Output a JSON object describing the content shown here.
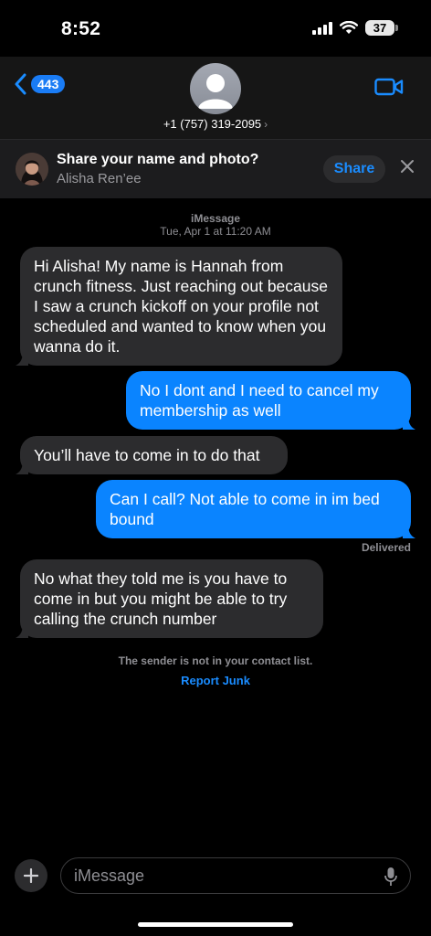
{
  "status_bar": {
    "time": "8:52",
    "battery": "37",
    "icons": [
      "signal-icon",
      "wifi-icon",
      "battery-icon"
    ]
  },
  "header": {
    "back_count": "443",
    "phone_number": "+1 (757) 319-2095",
    "icons": [
      "back-chevron-icon",
      "avatar-icon",
      "video-call-icon"
    ]
  },
  "share_banner": {
    "title": "Share your name and photo?",
    "name": "Alisha Ren’ee",
    "button": "Share"
  },
  "conversation": {
    "service": "iMessage",
    "timestamp": "Tue, Apr 1 at 11:20 AM",
    "messages": [
      {
        "dir": "in",
        "text": "Hi Alisha! My name is Hannah from crunch fitness.  Just reaching out because I saw a crunch kickoff on your profile not scheduled and wanted to know when you wanna do it."
      },
      {
        "dir": "out",
        "text": "No I dont and I need to cancel my membership as well"
      },
      {
        "dir": "in",
        "text": "You’ll have to come in to do that"
      },
      {
        "dir": "out",
        "text": "Can I call? Not able to come in im bed bound"
      },
      {
        "dir": "in",
        "text": "No what they told me is you have to come in but you might be able to try calling the crunch number"
      }
    ],
    "delivered": "Delivered",
    "not_in_contacts": "The sender is not in your contact list.",
    "report_junk": "Report Junk"
  },
  "composer": {
    "placeholder": "iMessage"
  },
  "colors": {
    "accent": "#0a84ff",
    "incoming_bubble": "#2c2c2e",
    "background": "#000000"
  }
}
